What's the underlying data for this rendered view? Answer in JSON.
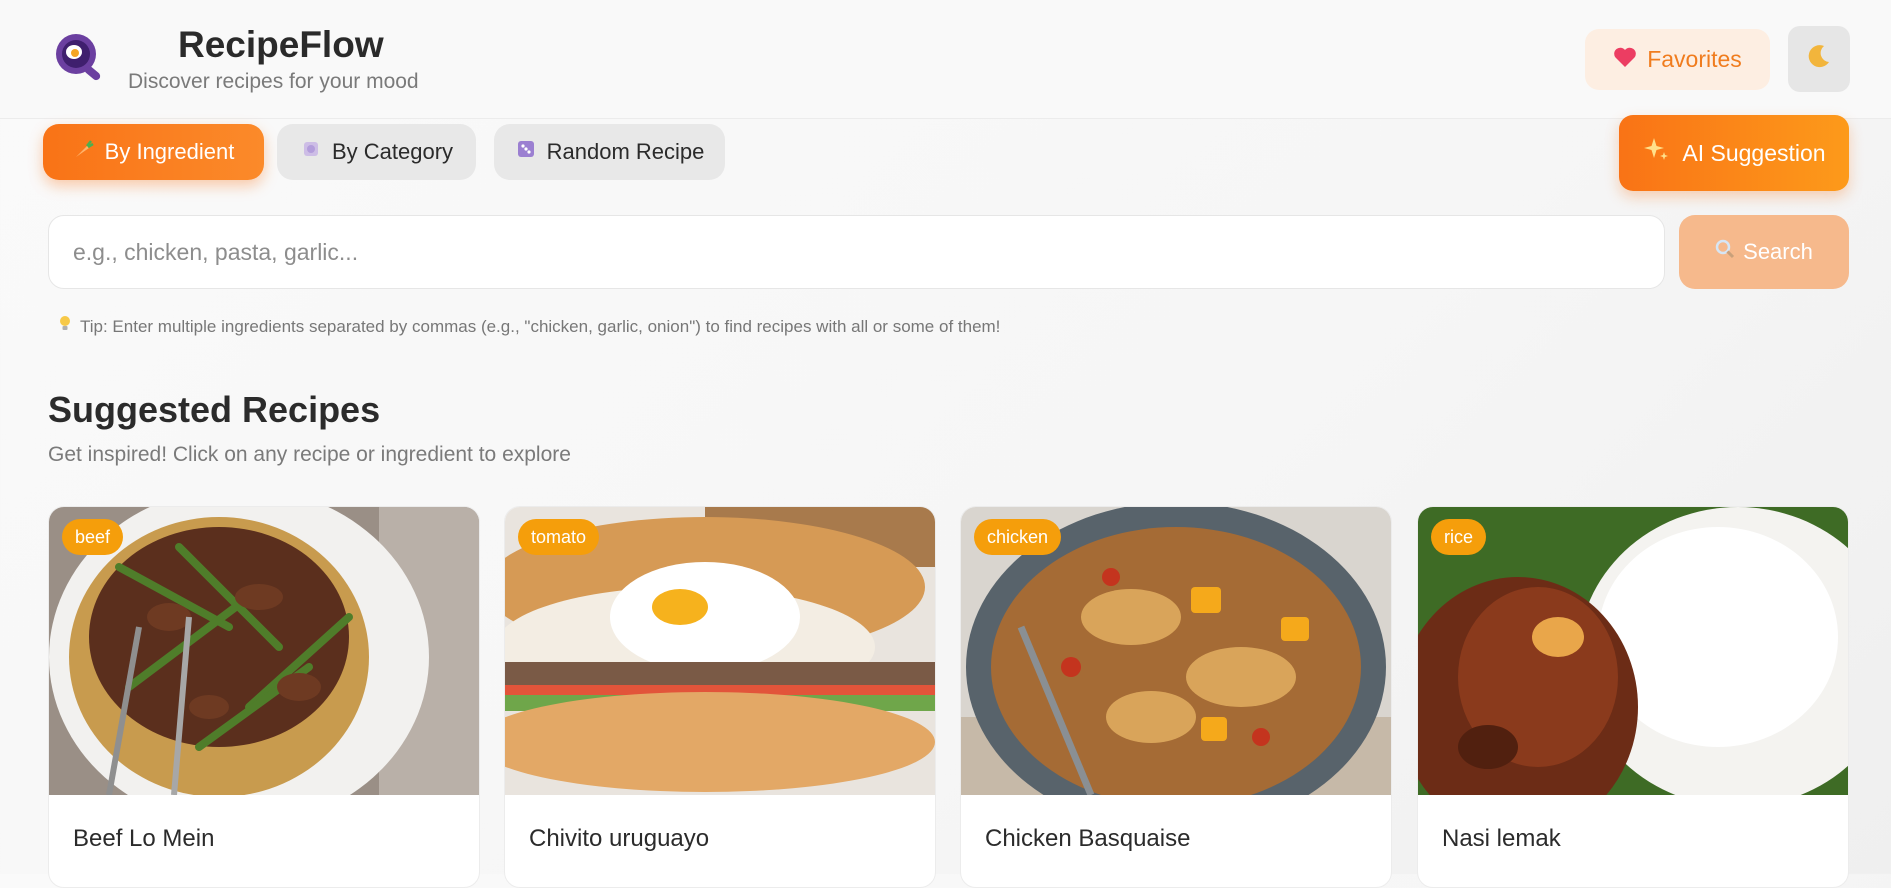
{
  "header": {
    "title": "RecipeFlow",
    "subtitle": "Discover recipes for your mood",
    "favorites_label": "Favorites",
    "favorites_icon": "heart-icon",
    "theme_icon": "moon-icon"
  },
  "tabs": [
    {
      "label": "By Ingredient",
      "icon": "carrot-icon",
      "active": true
    },
    {
      "label": "By Category",
      "icon": "plate-icon",
      "active": false
    },
    {
      "label": "Random Recipe",
      "icon": "dice-icon",
      "active": false
    }
  ],
  "ai_button": {
    "label": "AI Suggestion",
    "icon": "sparkles-icon"
  },
  "search": {
    "placeholder": "e.g., chicken, pasta, garlic...",
    "value": "",
    "button_label": "Search"
  },
  "tip": "Tip: Enter multiple ingredients separated by commas (e.g., \"chicken, garlic, onion\") to find recipes with all or some of them!",
  "section": {
    "title": "Suggested Recipes",
    "subtitle": "Get inspired! Click on any recipe or ingredient to explore"
  },
  "recipes": [
    {
      "tag": "beef",
      "title": "Beef Lo Mein"
    },
    {
      "tag": "tomato",
      "title": "Chivito uruguayo"
    },
    {
      "tag": "chicken",
      "title": "Chicken Basquaise"
    },
    {
      "tag": "rice",
      "title": "Nasi lemak"
    }
  ],
  "colors": {
    "accent": "#f97316",
    "tag": "#f59e0b",
    "search_button": "#f6b98c",
    "favorites_bg": "#fdeee2"
  }
}
